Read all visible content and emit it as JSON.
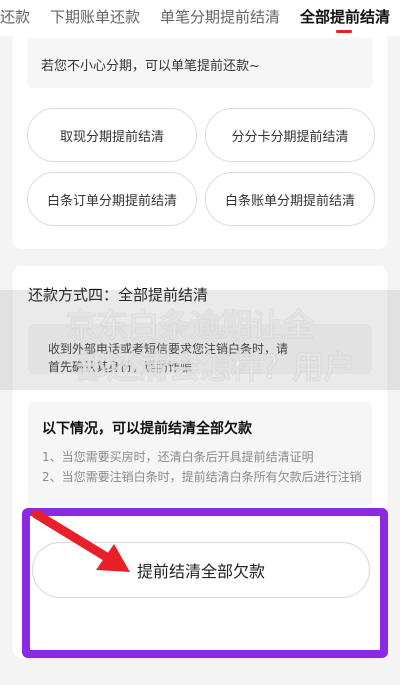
{
  "tabs": [
    {
      "label": "还款",
      "active": false
    },
    {
      "label": "下期账单还款",
      "active": false
    },
    {
      "label": "单笔分期提前结清",
      "active": false
    },
    {
      "label": "全部提前结清",
      "active": true
    }
  ],
  "section3": {
    "note": "若您不小心分期，可以单笔提前还款~",
    "options": [
      "取现分期提前结清",
      "分分卡分期提前结清",
      "白条订单分期提前结清",
      "白条账单分期提前结清"
    ]
  },
  "section4": {
    "title": "还款方式四：全部提前结清",
    "sms_line1": "收到外部电话或者短信要求您注销白条时，请",
    "sms_line2": "首先确认其身份，谨防诈骗",
    "info_title": "以下情况，可以提前结清全部欠款",
    "info_item1": "1、当您需要买房时，还清白条后开具提前结清证明",
    "info_item2": "2、当您需要注销白条时，提前结清白条所有欠款后进行注销",
    "button_label": "提前结清全部欠款"
  },
  "watermark": {
    "line1": "京东白条逾期让全",
    "line2": "部还清会怎样？用户"
  },
  "colors": {
    "accent": "#e2231a",
    "highlight_border": "#8a2be2",
    "arrow": "#e8202a"
  }
}
